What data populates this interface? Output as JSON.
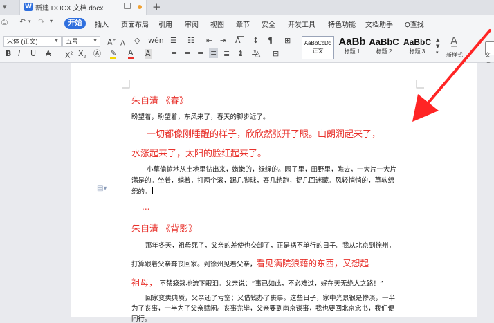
{
  "titlebar": {
    "tab_title": "新建 DOCX 文档.docx",
    "new_tab": "+"
  },
  "menu": {
    "active": "开始",
    "items": [
      "插入",
      "页面布局",
      "引用",
      "审阅",
      "视图",
      "章节",
      "安全",
      "开发工具",
      "特色功能",
      "文档助手"
    ],
    "search": "Q查找"
  },
  "toolbar": {
    "font_name": "宋体 (正文)",
    "font_size": "五号",
    "styles": [
      {
        "sample": "AaBbCcDd",
        "label": "正文"
      },
      {
        "sample": "AaBb",
        "label": "标题 1"
      },
      {
        "sample": "AaBbC",
        "label": "标题 2"
      },
      {
        "sample": "AaBbC",
        "label": "标题 3"
      }
    ],
    "new_style": "新样式",
    "doc_label": "文档"
  },
  "colors": {
    "accent": "#2f6fde",
    "red_text": "#e8322c",
    "highlight": "#f5d600",
    "font_red": "#e8322c"
  },
  "document": {
    "title1": "朱自清 《春》",
    "p1": "盼望着，盼望着，东风来了，春天的脚步近了。",
    "red_line1": "一切都像刚睡醒的样子，欣欣然张开了眼。山朗润起来了，",
    "red_line2": "水涨起来了，太阳的脸红起来了。",
    "p2_line1": "小草偷偷地从土地里钻出来，嫩嫩的，绿绿的。园子里，田野里，瞧去，一大片一大片",
    "p2_line2": "满是的。坐着，躺着，打两个滚，踢几脚球，赛几趟跑，捉几回迷藏。风轻悄悄的，草软绵",
    "p2_line3": "绵的。",
    "ellipsis": "...",
    "title2": "朱自清 《背影》",
    "p3_line1": "那年冬天，祖母死了，父亲的差使也交卸了，正是祸不单行的日子。我从北京到徐州，",
    "p3_line2_black": "打算跟着父亲奔丧回家。到徐州见着父亲，",
    "p3_line2_red": "看见满院狼藉的东西，又想起",
    "p3_line3_red": "祖母，",
    "p3_line3_black": "不禁簌簌地流下眼泪。父亲说：“事已如此，不必难过，好在天无绝人之路！”",
    "p4_line1": "回家变卖典质，父亲还了亏空；又借钱办了丧事。这些日子，家中光景很是惨淡，一半",
    "p4_line2": "为了丧事，一半为了父亲赋闲。丧事完毕，父亲要到南京谋事，我也要回北京念书，我们便",
    "p4_line3": "同行。"
  }
}
